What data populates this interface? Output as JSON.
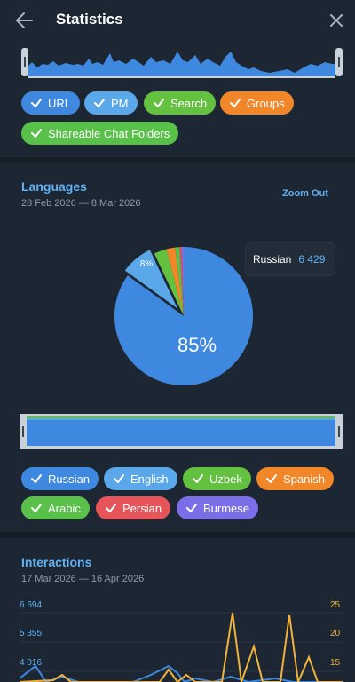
{
  "header": {
    "title": "Statistics",
    "back_icon": "arrow-left-icon",
    "close_icon": "close-icon"
  },
  "top_filter": {
    "chips": [
      {
        "label": "URL",
        "color": "#3e88e0"
      },
      {
        "label": "PM",
        "color": "#5aa7ea"
      },
      {
        "label": "Search",
        "color": "#63c13f"
      },
      {
        "label": "Groups",
        "color": "#f2872a"
      },
      {
        "label": "Shareable Chat Folders",
        "color": "#59c04a"
      }
    ]
  },
  "languages": {
    "title": "Languages",
    "date_range": "28 Feb 2026 — 8 Mar 2026",
    "zoom_out": "Zoom Out",
    "pie_labels": {
      "large": "85%",
      "small": "8%"
    },
    "tooltip": {
      "language": "Russian",
      "value": "6 429"
    },
    "chips": [
      {
        "label": "Russian",
        "color": "#3e88e0"
      },
      {
        "label": "English",
        "color": "#5aa7ea"
      },
      {
        "label": "Uzbek",
        "color": "#63c13f"
      },
      {
        "label": "Spanish",
        "color": "#f2872a"
      },
      {
        "label": "Arabic",
        "color": "#59c04a"
      },
      {
        "label": "Persian",
        "color": "#e5555a"
      },
      {
        "label": "Burmese",
        "color": "#7c6ee6"
      }
    ]
  },
  "interactions": {
    "title": "Interactions",
    "date_range": "17 Mar 2026 — 16 Apr 2026",
    "left_axis": [
      "6 694",
      "5 355",
      "4 016"
    ],
    "right_axis": [
      "25",
      "20",
      "15"
    ]
  },
  "chart_data": [
    {
      "type": "pie",
      "labels": [
        "Russian",
        "English",
        "Uzbek",
        "Spanish",
        "Arabic",
        "Persian",
        "Burmese"
      ],
      "values": [
        85,
        8,
        3,
        2,
        1,
        0.5,
        0.5
      ],
      "data_labels": [
        "85%",
        "8%"
      ],
      "colors": [
        "#3e88e0",
        "#5aa7ea",
        "#63c13f",
        "#f2872a",
        "#59c04a",
        "#e5555a",
        "#7c6ee6"
      ]
    },
    {
      "type": "line",
      "series_colors": [
        "#3e88e0",
        "#f0b23c"
      ],
      "left_ticks": [
        4016,
        5355,
        6694
      ],
      "right_ticks": [
        15,
        20,
        25
      ]
    }
  ]
}
